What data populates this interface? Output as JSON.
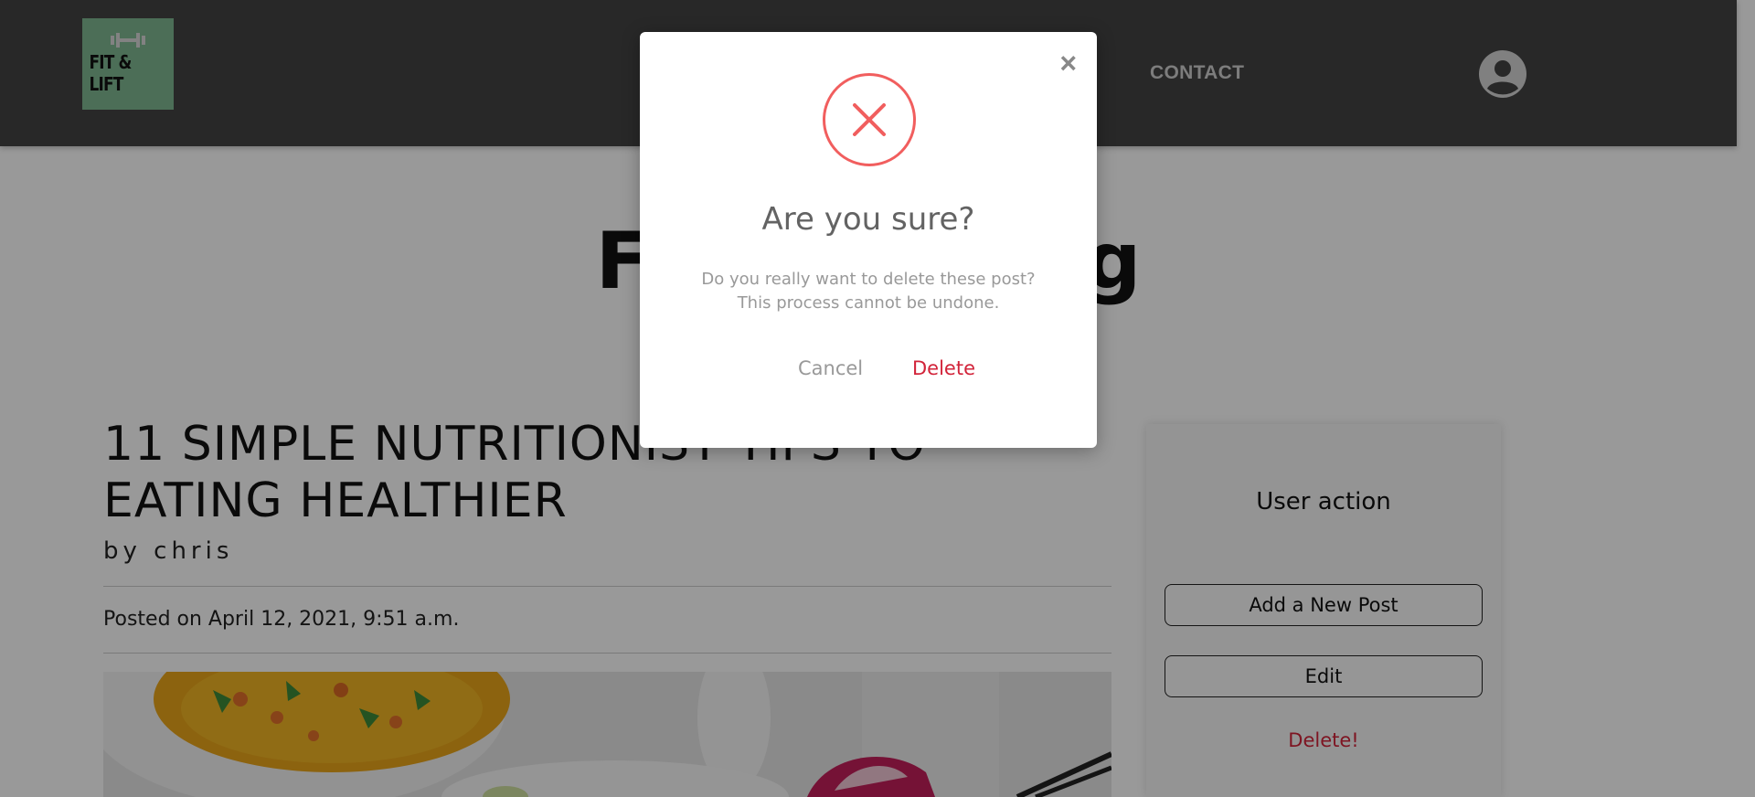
{
  "header": {
    "logo_text": "FIT & LIFT",
    "nav_contact": "CONTACT",
    "avatar_icon": "user-avatar-icon"
  },
  "page": {
    "blog_title": "Fitness Blog",
    "post_title": "11 SIMPLE NUTRITIONIST TIPS TO EATING HEALTHIER",
    "post_author": "by chris",
    "post_date": "Posted on April 12, 2021, 9:51 a.m."
  },
  "sidebar": {
    "title": "User action",
    "add_post_label": "Add a New Post",
    "edit_label": "Edit",
    "delete_label": "Delete!"
  },
  "modal": {
    "close_label": "×",
    "icon": "x-circle-icon",
    "heading": "Are you sure?",
    "body_line1": "Do you really want to delete these post?",
    "body_line2": "This process cannot be undone.",
    "cancel_label": "Cancel",
    "delete_label": "Delete"
  },
  "colors": {
    "danger": "#d2243a",
    "icon_red": "#f15e5e",
    "header_bg": "#444444",
    "logo_bg": "#7fb792"
  }
}
